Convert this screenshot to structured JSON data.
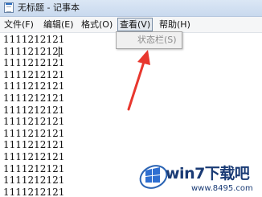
{
  "window": {
    "title": "无标题 - 记事本"
  },
  "menubar": {
    "items": [
      {
        "label": "文件(F)"
      },
      {
        "label": "编辑(E)"
      },
      {
        "label": "格式(O)"
      },
      {
        "label": "查看(V)",
        "state": "open"
      },
      {
        "label": "帮助(H)"
      }
    ]
  },
  "view_menu": {
    "items": [
      {
        "label": "状态栏(S)",
        "enabled": false
      }
    ]
  },
  "editor": {
    "lines": [
      "1111212121",
      "1111212121",
      "1111212121",
      "1111212121",
      "1111212121",
      "1111212121",
      "1111212121",
      "1111212121",
      "1111212121",
      "1111212121",
      "1111212121",
      "1111212121",
      "1111212121",
      "1111212121"
    ]
  },
  "annotation": {
    "arrow_color": "#e8372e"
  },
  "watermark": {
    "brand": "win7下载吧",
    "url": "www.8495.com"
  },
  "colors": {
    "titlebar": "#c9d9ee",
    "menubar": "#f5f6f7",
    "menu_open_border": "#7a8ea6",
    "disabled_text": "#8a8a8a",
    "watermark": "#1a3b75"
  },
  "icons": {
    "app": "notepad-icon",
    "watermark_logo": "windows-logo-icon"
  }
}
